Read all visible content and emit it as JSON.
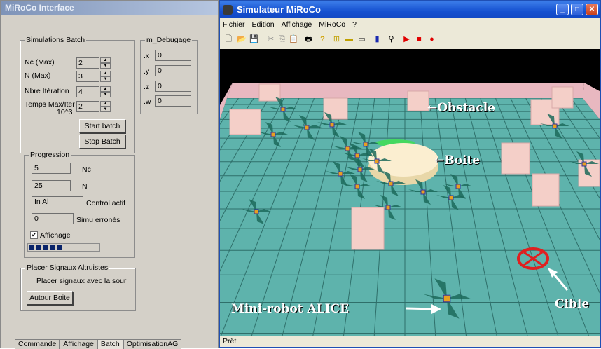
{
  "left_window": {
    "title": "MiRoCo Interface",
    "batch_group": {
      "legend": "Simulations Batch",
      "nc_label": "Nc (Max)",
      "nc_value": "2",
      "n_label": "N (Max)",
      "n_value": "3",
      "iter_label": "Nbre Itération",
      "iter_value": "4",
      "temps_label": "Temps Max/Iter",
      "temps_sub": "10^3",
      "temps_value": "2",
      "start_label": "Start batch",
      "stop_label": "Stop Batch"
    },
    "debug_group": {
      "legend": "m_Debugage",
      "x_label": ".x",
      "x_value": "0",
      "y_label": ".y",
      "y_value": "0",
      "z_label": ".z",
      "z_value": "0",
      "w_label": ".w",
      "w_value": "0"
    },
    "progress_group": {
      "legend": "Progression",
      "nc_value": "5",
      "nc_label": "Nc",
      "n_value": "25",
      "n_label": "N",
      "control_value": "In Al",
      "control_label": "Control actif",
      "errors_value": "0",
      "errors_label": "Simu erronés",
      "affichage_label": "Affichage",
      "affichage_checked": true,
      "progress_fraction": 0.5
    },
    "signals_group": {
      "legend": "Placer Signaux Altruistes",
      "checkbox_label": "Placer signaux avec la souri",
      "button_label": "Autour Boite"
    },
    "tabs": [
      "Commande",
      "Affichage",
      "Batch",
      "OptimisationAG"
    ],
    "active_tab": "Batch"
  },
  "right_window": {
    "title": "Simulateur MiRoCo",
    "menu": [
      "Fichier",
      "Edition",
      "Affichage",
      "MiRoCo",
      "?"
    ],
    "status": "Prêt",
    "annotations": {
      "obstacle": "←Obstacle",
      "boite": "←Boite",
      "robot": "Mini-robot ALICE",
      "cible": "Cible"
    },
    "colors": {
      "floor": "#5eb3ac",
      "grid": "#2f6f6a",
      "wall": "#e8b8c0",
      "box": "#f4cfc8",
      "target": "#e02020"
    }
  }
}
